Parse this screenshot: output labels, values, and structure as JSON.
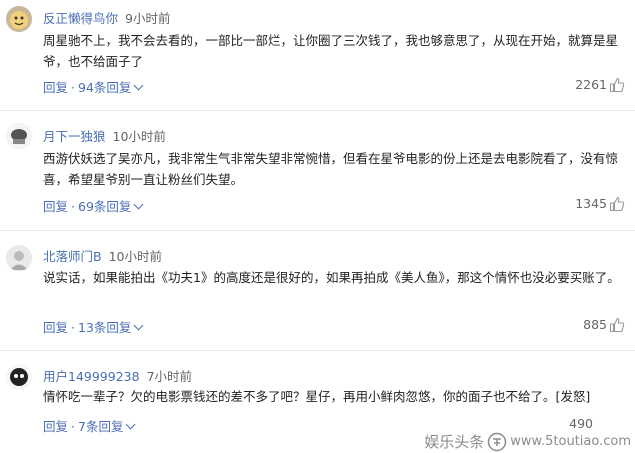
{
  "comments": [
    {
      "user": "反正懒得鸟你",
      "time": "9小时前",
      "text": "周星驰不上，我不会去看的，一部比一部烂，让你圈了三次钱了，我也够意思了，从现在开始，就算是星爷，也不给面子了",
      "reply_label": "回复",
      "replies_label": "94条回复",
      "likes": "2261"
    },
    {
      "user": "月下一独狼",
      "time": "10小时前",
      "text": "西游伏妖选了吴亦凡，我非常生气非常失望非常惋惜，但看在星爷电影的份上还是去电影院看了，没有惊喜，希望星爷别一直让粉丝们失望。",
      "reply_label": "回复",
      "replies_label": "69条回复",
      "likes": "1345"
    },
    {
      "user": "北落师门B",
      "time": "10小时前",
      "text": "说实话，如果能拍出《功夫1》的高度还是很好的，如果再拍成《美人鱼》，那这个情怀也没必要买账了。",
      "reply_label": "回复",
      "replies_label": "13条回复",
      "likes": "885"
    },
    {
      "user": "用户149999238",
      "time": "7小时前",
      "text": "情怀吃一辈子？欠的电影票钱还的差不多了吧？星仔，再用小鲜肉忽悠，你的面子也不给了。[发怒]",
      "reply_label": "回复",
      "replies_label": "7条回复",
      "likes": "490"
    }
  ],
  "watermark": {
    "brand": "娱乐头条",
    "url": "www.5toutiao.com"
  },
  "colors": {
    "username": "#4a6eb5",
    "link": "#4a6eb5",
    "muted": "#666666"
  },
  "icons": [
    "avatar",
    "thumbs-up-icon",
    "chevron-down-icon",
    "watermark-logo-icon"
  ]
}
